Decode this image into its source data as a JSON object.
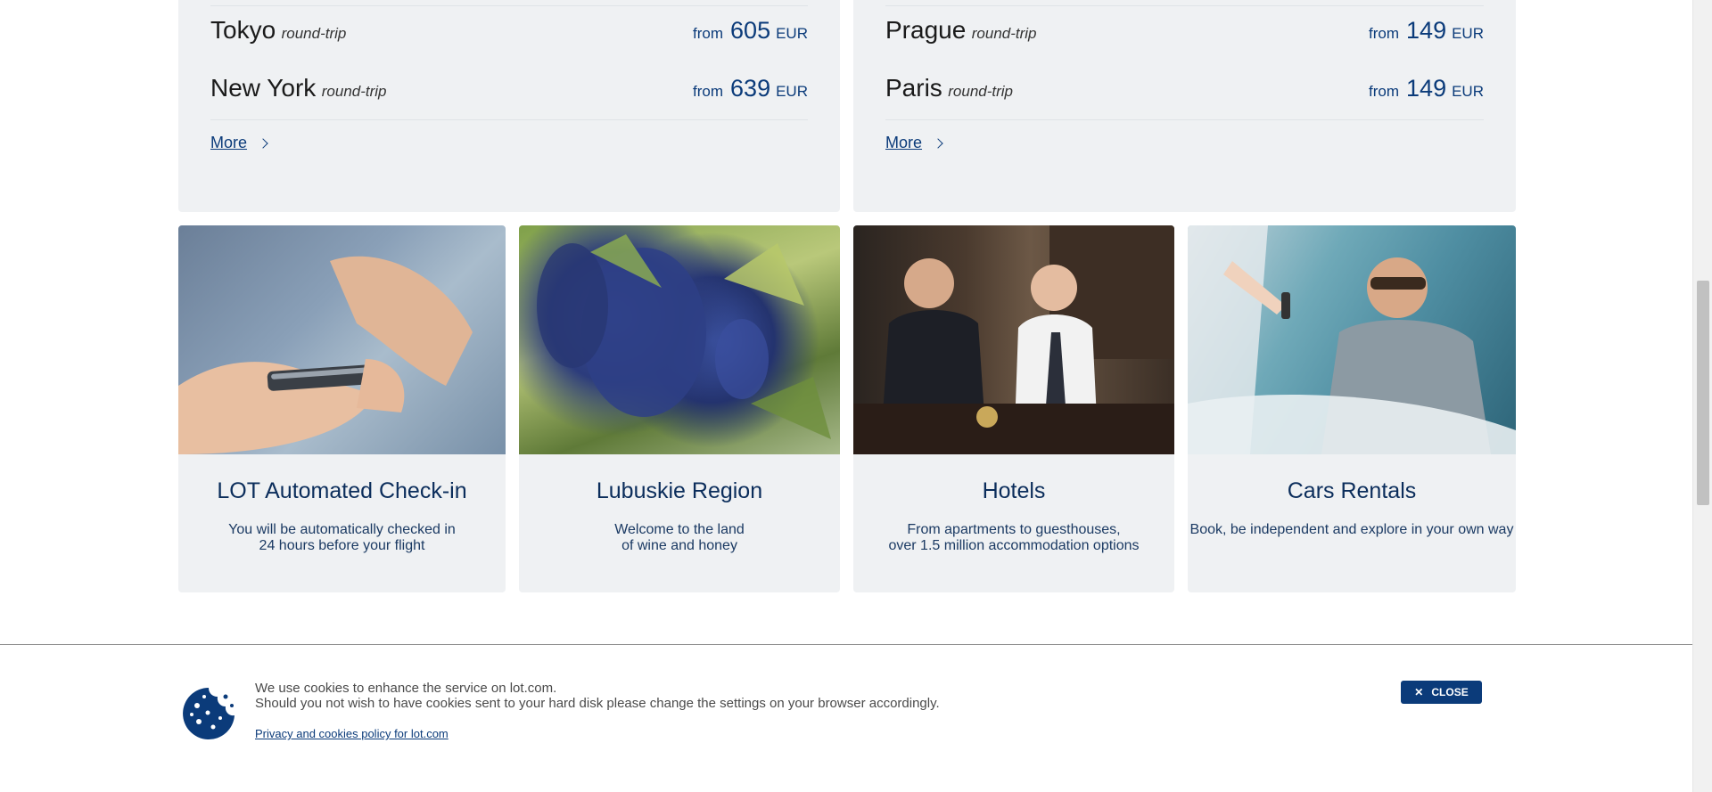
{
  "routes": {
    "left": [
      {
        "city": "Tokyo",
        "trip": "round-trip",
        "from": "from",
        "amount": "605",
        "currency": "EUR"
      },
      {
        "city": "New York",
        "trip": "round-trip",
        "from": "from",
        "amount": "639",
        "currency": "EUR"
      }
    ],
    "right": [
      {
        "city": "Prague",
        "trip": "round-trip",
        "from": "from",
        "amount": "149",
        "currency": "EUR"
      },
      {
        "city": "Paris",
        "trip": "round-trip",
        "from": "from",
        "amount": "149",
        "currency": "EUR"
      }
    ],
    "more_label": "More"
  },
  "cards": [
    {
      "title": "LOT Automated Check-in",
      "desc": "You will be automatically checked in\n24 hours before your flight",
      "image": "smartphone-hands-photo"
    },
    {
      "title": "Lubuskie Region",
      "desc": "Welcome to the land\nof wine and honey",
      "image": "grapes-vineyard-photo"
    },
    {
      "title": "Hotels",
      "desc": "From apartments to guesthouses,\nover 1.5 million accommodation options",
      "image": "hotel-reception-photo"
    },
    {
      "title": "Cars Rentals",
      "desc": "Book, be independent and explore in your own way",
      "image": "car-keys-photo"
    }
  ],
  "cookie": {
    "line1": "We use cookies to enhance the service on lot.com.",
    "line2": "Should you not wish to have cookies sent to your hard disk please change the settings on your browser accordingly.",
    "policy_link": "Privacy and cookies policy for lot.com",
    "close_label": "CLOSE",
    "icon": "cookie-icon"
  },
  "colors": {
    "brand": "#0b3b7a",
    "panel_bg": "#eff1f3"
  }
}
